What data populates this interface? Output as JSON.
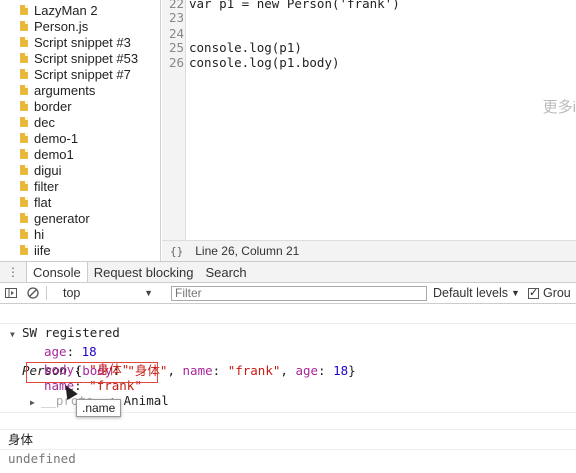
{
  "sidebar": {
    "items": [
      {
        "label": "LazyMan 2"
      },
      {
        "label": "Person.js"
      },
      {
        "label": "Script snippet #3"
      },
      {
        "label": "Script snippet #53"
      },
      {
        "label": "Script snippet #7"
      },
      {
        "label": "arguments"
      },
      {
        "label": "border"
      },
      {
        "label": "dec"
      },
      {
        "label": "demo-1"
      },
      {
        "label": "demo1"
      },
      {
        "label": "digui"
      },
      {
        "label": "filter"
      },
      {
        "label": "flat"
      },
      {
        "label": "generator"
      },
      {
        "label": "hi"
      },
      {
        "label": "iife"
      }
    ]
  },
  "editor": {
    "lines": [
      {
        "num": "22",
        "code": "var p1 = new Person('frank')"
      },
      {
        "num": "23",
        "code": ""
      },
      {
        "num": "24",
        "code": ""
      },
      {
        "num": "25",
        "code": "console.log(p1)"
      },
      {
        "num": "26",
        "code": "console.log(p1.body)"
      }
    ],
    "overlay_text": "更多i",
    "status_brace": "{}",
    "status_position": "Line 26, Column 21"
  },
  "drawer": {
    "menu_icon": "⋮",
    "tabs": [
      "Console",
      "Request blocking",
      "Search"
    ]
  },
  "toolbar": {
    "context": "top",
    "filter_placeholder": "Filter",
    "levels": "Default levels",
    "group_label": "Grou"
  },
  "console": {
    "sw_registered": "SW registered",
    "obj_class": "Person",
    "obj_open": " {",
    "obj_body_key": "body",
    "obj_body_val": "\"身体\"",
    "obj_name_key": "name",
    "obj_name_val": "\"frank\"",
    "obj_age_key": "age",
    "obj_age_val": "18",
    "obj_close": "}",
    "prop_age_key": "age",
    "prop_age_val": "18",
    "prop_body_key": "body",
    "prop_body_val": "\"身体\"",
    "prop_name_key": "name",
    "prop_name_val": "\"frank\"",
    "proto_key": "__proto__",
    "proto_val": "Animal",
    "body_output": "身体",
    "undefined_output": "undefined",
    "tooltip": ".name",
    "prompt_icon": "›"
  },
  "colors": {
    "highlight": "#e0473c",
    "key": "#a7289b",
    "string": "#c41a16",
    "number": "#1c00cf"
  }
}
